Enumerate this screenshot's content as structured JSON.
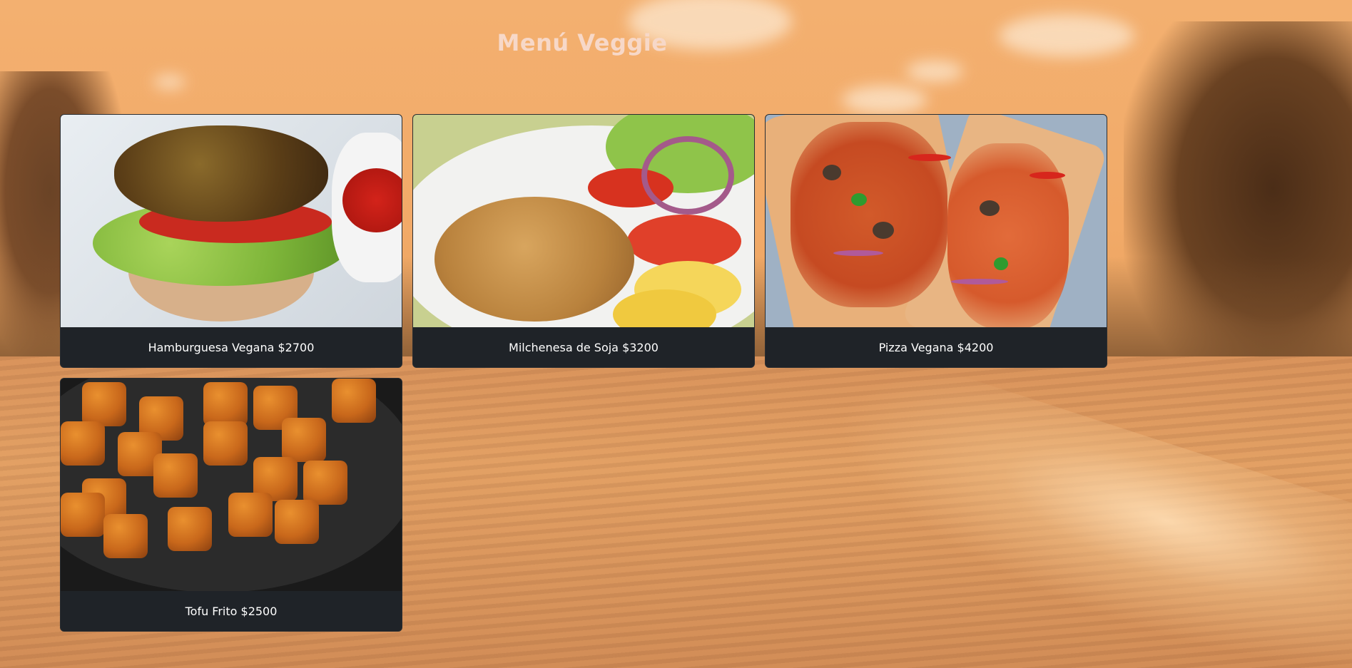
{
  "page": {
    "title": "Menú Veggie"
  },
  "menu": {
    "items": [
      {
        "name": "Hamburguesa Vegana $2700",
        "image": "vegan-burger"
      },
      {
        "name": "Milchenesa de Soja $3200",
        "image": "soy-milanesa"
      },
      {
        "name": "Pizza Vegana $4200",
        "image": "vegan-pizza"
      },
      {
        "name": "Tofu Frito $2500",
        "image": "fried-tofu"
      }
    ]
  },
  "colors": {
    "background_tint": "#f0ad6c",
    "title": "#f7d8c8",
    "card_footer": "#1f2328",
    "caption_text": "#ffffff"
  }
}
